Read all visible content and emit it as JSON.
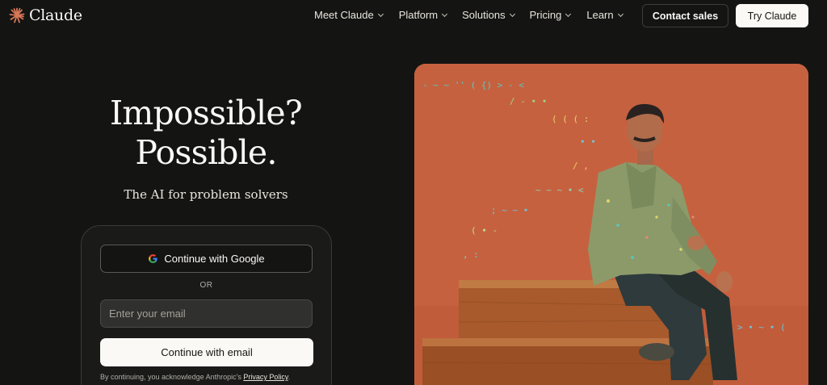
{
  "header": {
    "logo_text": "Claude",
    "nav": [
      {
        "label": "Meet Claude"
      },
      {
        "label": "Platform"
      },
      {
        "label": "Solutions"
      },
      {
        "label": "Pricing"
      },
      {
        "label": "Learn"
      }
    ],
    "contact_sales": "Contact sales",
    "try_claude": "Try Claude"
  },
  "hero": {
    "title_line1": "Impossible?",
    "title_line2": "Possible.",
    "subtitle": "The AI for problem solvers"
  },
  "signin": {
    "google_button": "Continue with Google",
    "or_label": "OR",
    "email_placeholder": "Enter your email",
    "email_value": "",
    "email_button": "Continue with email",
    "legal_prefix": "By continuing, you acknowledge Anthropic's ",
    "legal_link": "Privacy Policy",
    "legal_suffix": "."
  },
  "icons": {
    "logo": "claude-starburst-icon",
    "google": "google-g-icon",
    "dropdown": "chevron-down-icon"
  },
  "colors": {
    "background": "#141413",
    "text_primary": "#faf9f5",
    "brand_orange": "#d97757",
    "hero_backdrop": "#c6613f",
    "button_light": "#faf9f5",
    "input_bg": "#30302e"
  }
}
